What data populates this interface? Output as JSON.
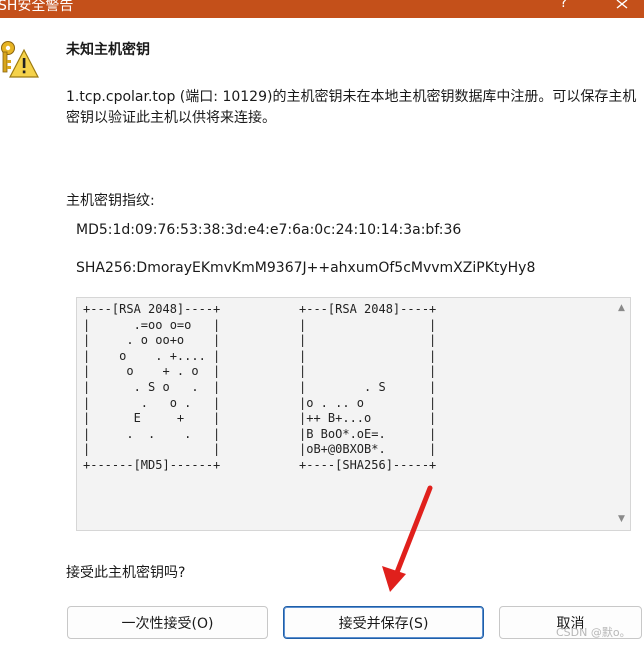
{
  "window": {
    "title": "SH安全警告",
    "help_glyph": "?"
  },
  "dialog": {
    "heading": "未知主机密钥",
    "message": "1.tcp.cpolar.top (端口: 10129)的主机密钥未在本地主机密钥数据库中注册。可以保存主机密钥以验证此主机以供将来连接。",
    "fingerprint_label": "主机密钥指纹:",
    "md5": "MD5:1d:09:76:53:38:3d:e4:e7:6a:0c:24:10:14:3a:bf:36",
    "sha256": "SHA256:DmorayEKmvKmM9367J++ahxumOf5cMvvmXZiPKtyHy8",
    "randomart_md5": "+---[RSA 2048]----+\n|      .=oo o=o   |\n|     . o oo+o    |\n|    o    . +.... |\n|     o    + . o  |\n|      . S o   .  |\n|       .   o .   |\n|      E     +    |\n|     .  .    .   |\n|                 |\n+------[MD5]------+",
    "randomart_sha256": "+---[RSA 2048]----+\n|                 |\n|                 |\n|                 |\n|                 |\n|        . S      |\n|o . .. o         |\n|++ B+...o        |\n|B BoO*.oE=.      |\n|oB+@0BXOB*.      |\n+----[SHA256]-----+",
    "question": "接受此主机密钥吗?"
  },
  "buttons": {
    "accept_once": "一次性接受(O)",
    "accept_save": "接受并保存(S)",
    "cancel": "取消"
  },
  "watermark": "CSDN @默o。",
  "colors": {
    "titlebar": "#c4501a",
    "annotation_arrow": "#e0201c",
    "default_button_border": "#1f5fa8"
  },
  "icons": [
    "keys-warning-icon",
    "close-icon",
    "scroll-up-arrow",
    "scroll-down-arrow"
  ]
}
